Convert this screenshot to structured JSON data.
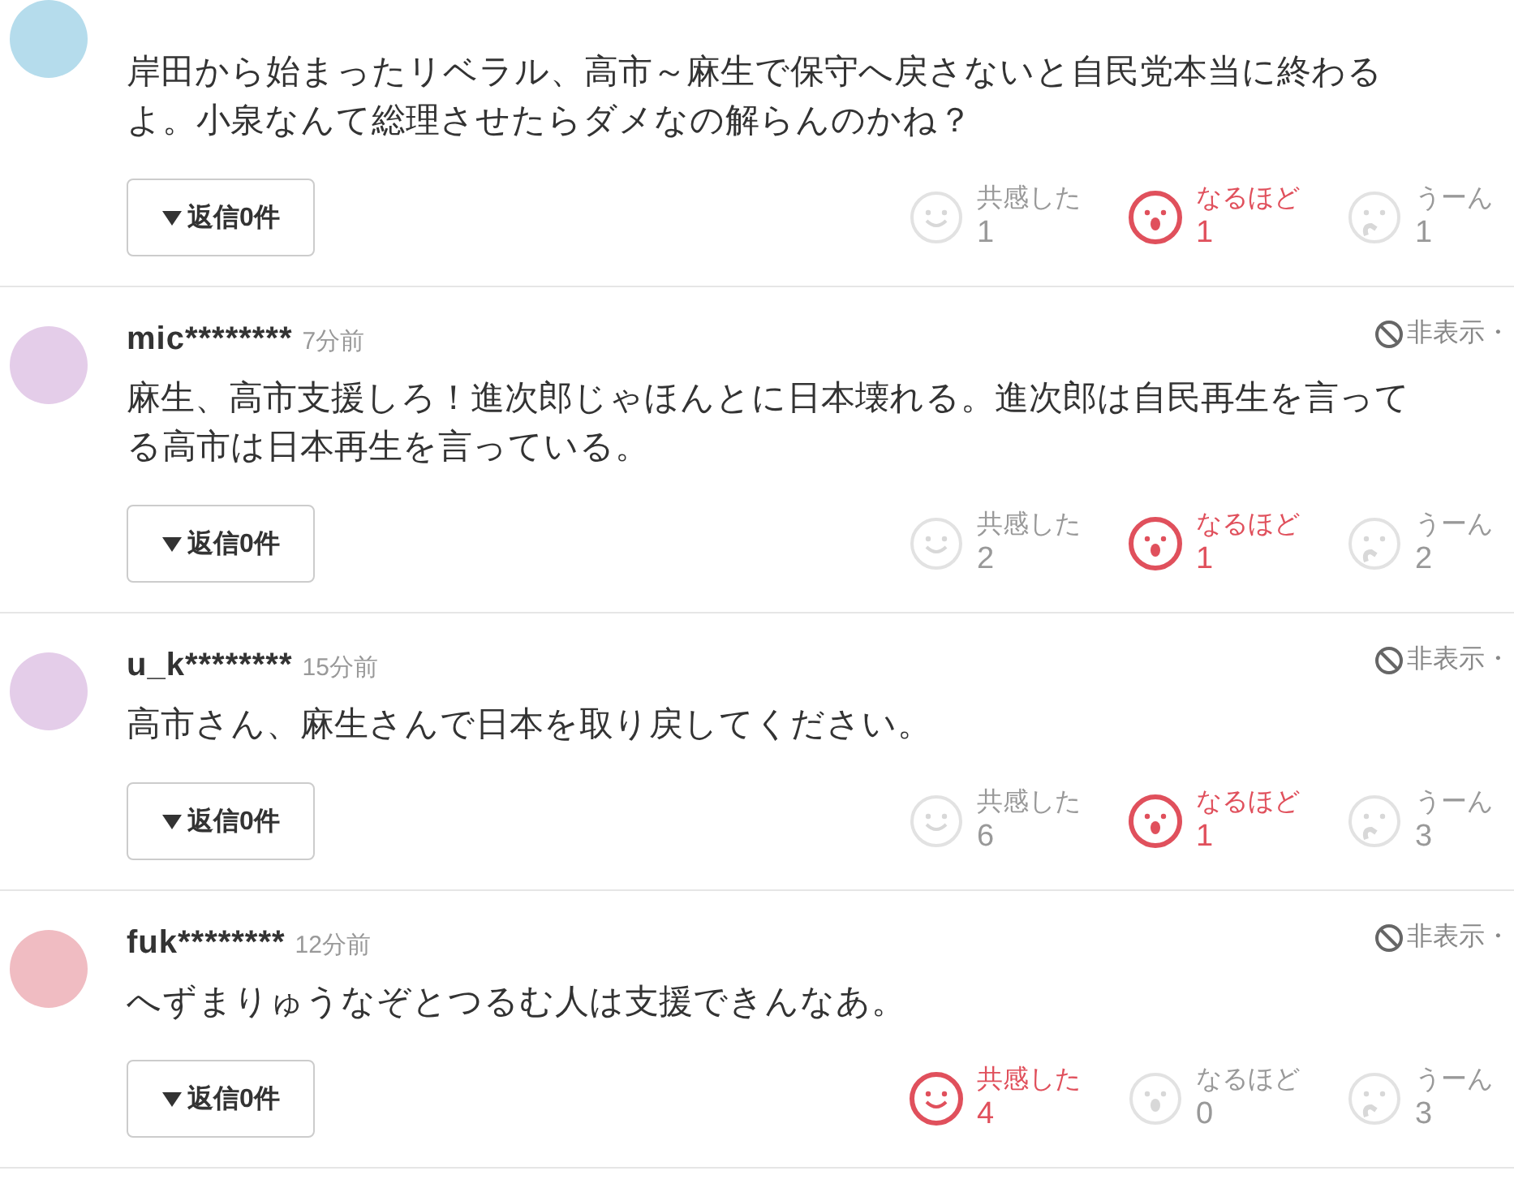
{
  "comments": [
    {
      "color": "#b5dcec",
      "text": "岸田から始まったリベラル、高市～麻生で保守へ戻さないと自民党本当に終わるよ。小泉なんて総理させたらダメなの解らんのかね？",
      "reply": "返信0件",
      "reactions": [
        {
          "kind": "empathy",
          "label": "共感した",
          "count": "1",
          "selected": false
        },
        {
          "kind": "insight",
          "label": "なるほど",
          "count": "1",
          "selected": true
        },
        {
          "kind": "hmm",
          "label": "うーん",
          "count": "1",
          "selected": false
        }
      ]
    },
    {
      "color": "#e4cde9",
      "name": "mic********",
      "time": "7分前",
      "text": "麻生、高市支援しろ！進次郎じゃほんとに日本壊れる。進次郎は自民再生を言ってる高市は日本再生を言っている。",
      "hide": "非表示・",
      "reply": "返信0件",
      "reactions": [
        {
          "kind": "empathy",
          "label": "共感した",
          "count": "2",
          "selected": false
        },
        {
          "kind": "insight",
          "label": "なるほど",
          "count": "1",
          "selected": true
        },
        {
          "kind": "hmm",
          "label": "うーん",
          "count": "2",
          "selected": false
        }
      ]
    },
    {
      "color": "#e4cde9",
      "name": "u_k********",
      "time": "15分前",
      "text": "高市さん、麻生さんで日本を取り戻してください。",
      "hide": "非表示・",
      "reply": "返信0件",
      "reactions": [
        {
          "kind": "empathy",
          "label": "共感した",
          "count": "6",
          "selected": false
        },
        {
          "kind": "insight",
          "label": "なるほど",
          "count": "1",
          "selected": true
        },
        {
          "kind": "hmm",
          "label": "うーん",
          "count": "3",
          "selected": false
        }
      ]
    },
    {
      "color": "#f0bcc2",
      "name": "fuk********",
      "time": "12分前",
      "text": "へずまりゅうなぞとつるむ人は支援できんなあ。",
      "hide": "非表示・",
      "reply": "返信0件",
      "reactions": [
        {
          "kind": "empathy",
          "label": "共感した",
          "count": "4",
          "selected": true
        },
        {
          "kind": "insight",
          "label": "なるほど",
          "count": "0",
          "selected": false
        },
        {
          "kind": "hmm",
          "label": "うーん",
          "count": "3",
          "selected": false
        }
      ]
    }
  ]
}
